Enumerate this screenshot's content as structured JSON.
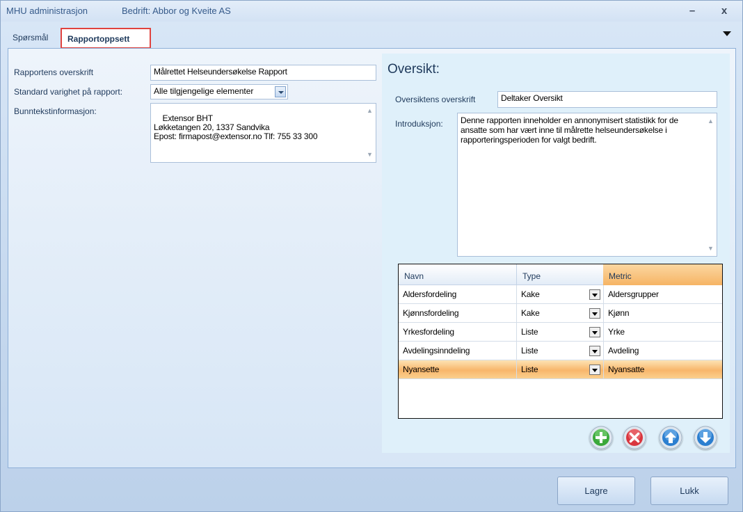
{
  "window": {
    "app_title": "MHU administrasjon",
    "company_label": "Bedrift: Abbor og Kveite AS",
    "minimize_glyph": "–",
    "close_glyph": "x"
  },
  "tabs": [
    {
      "label": "Spørsmål",
      "selected": false
    },
    {
      "label": "Rapportoppsett",
      "selected": true
    }
  ],
  "report": {
    "heading_label": "Rapportens overskrift",
    "heading_value": "Målrettet Helseundersøkelse Rapport",
    "duration_label": "Standard varighet på rapport:",
    "duration_value": "Alle tilgjengelige elementer",
    "footer_label": "Bunntekstinformasjon:",
    "footer_value": "Extensor BHT\nLøkketangen 20, 1337 Sandvika\nEpost: firmapost@extensor.no Tlf: 755 33 300"
  },
  "overview": {
    "title": "Oversikt:",
    "heading_label": "Oversiktens overskrift",
    "heading_value": "Deltaker Oversikt",
    "intro_label": "Introduksjon:",
    "intro_value": "Denne rapporten inneholder en annonymisert statistikk for de ansatte som har vært inne til målrette helseundersøkelse i rapporteringsperioden for valgt bedrift."
  },
  "grid": {
    "columns": [
      "Navn",
      "Type",
      "Metric"
    ],
    "rows": [
      {
        "navn": "Aldersfordeling",
        "type": "Kake",
        "metric": "Aldersgrupper"
      },
      {
        "navn": "Kjønnsfordeling",
        "type": "Kake",
        "metric": "Kjønn"
      },
      {
        "navn": "Yrkesfordeling",
        "type": "Liste",
        "metric": "Yrke"
      },
      {
        "navn": "Avdelingsinndeling",
        "type": "Liste",
        "metric": "Avdeling"
      },
      {
        "navn": "Nyansette",
        "type": "Liste",
        "metric": "Nyansatte"
      }
    ],
    "selected_row": 4
  },
  "actions": {
    "add_icon": "add-icon",
    "remove_icon": "remove-icon",
    "up_icon": "move-up-icon",
    "down_icon": "move-down-icon"
  },
  "footer_buttons": {
    "save_label": "Lagre",
    "close_label": "Lukk"
  },
  "colors": {
    "selected_row": "#f8b66b",
    "tab_highlight": "#e0423e",
    "add": "#3aa83a",
    "remove": "#d9363e",
    "move": "#2c7fd0"
  }
}
